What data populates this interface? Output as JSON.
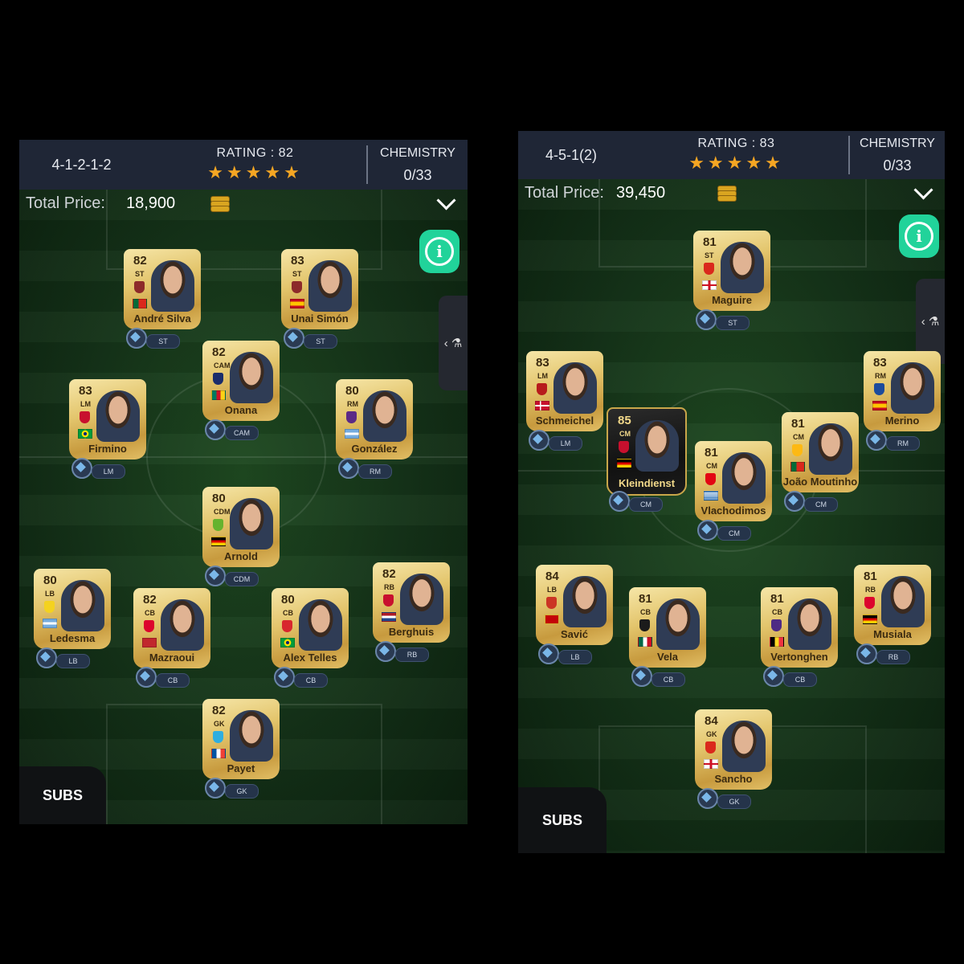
{
  "panels": [
    {
      "formation": "4-1-2-1-2",
      "rating": "RATING : 82",
      "stars": "★★★★★",
      "chemistry_label": "CHEMISTRY",
      "chemistry_value": "0/33",
      "price_label": "Total Price:",
      "price_value": "18,900",
      "subs_label": "SUBS",
      "players": [
        {
          "name": "André Silva",
          "ovr": "82",
          "pos": "ST",
          "slot": "ST",
          "flag": "portugal"
        },
        {
          "name": "Unai Simón",
          "ovr": "83",
          "pos": "ST",
          "slot": "ST",
          "flag": "spain"
        },
        {
          "name": "Onana",
          "ovr": "82",
          "pos": "CAM",
          "slot": "CAM",
          "flag": "cameroon"
        },
        {
          "name": "Firmino",
          "ovr": "83",
          "pos": "LM",
          "slot": "LM",
          "flag": "brazil"
        },
        {
          "name": "González",
          "ovr": "80",
          "pos": "RM",
          "slot": "RM",
          "flag": "argentina"
        },
        {
          "name": "Arnold",
          "ovr": "80",
          "pos": "CDM",
          "slot": "CDM",
          "flag": "germany"
        },
        {
          "name": "Ledesma",
          "ovr": "80",
          "pos": "LB",
          "slot": "LB",
          "flag": "argentina"
        },
        {
          "name": "Mazraoui",
          "ovr": "82",
          "pos": "CB",
          "slot": "CB",
          "flag": "morocco"
        },
        {
          "name": "Alex Telles",
          "ovr": "80",
          "pos": "CB",
          "slot": "CB",
          "flag": "brazil"
        },
        {
          "name": "Berghuis",
          "ovr": "82",
          "pos": "RB",
          "slot": "RB",
          "flag": "netherlands"
        },
        {
          "name": "Payet",
          "ovr": "82",
          "pos": "GK",
          "slot": "GK",
          "flag": "france"
        }
      ]
    },
    {
      "formation": "4-5-1(2)",
      "rating": "RATING : 83",
      "stars": "★★★★★",
      "chemistry_label": "CHEMISTRY",
      "chemistry_value": "0/33",
      "price_label": "Total Price:",
      "price_value": "39,450",
      "subs_label": "SUBS",
      "players": [
        {
          "name": "Maguire",
          "ovr": "81",
          "pos": "ST",
          "slot": "ST",
          "flag": "england"
        },
        {
          "name": "Schmeichel",
          "ovr": "83",
          "pos": "LM",
          "slot": "LM",
          "flag": "denmark"
        },
        {
          "name": "Merino",
          "ovr": "83",
          "pos": "RM",
          "slot": "RM",
          "flag": "spain"
        },
        {
          "name": "Kleindienst",
          "ovr": "85",
          "pos": "CM",
          "slot": "CM",
          "flag": "germany"
        },
        {
          "name": "Vlachodimos",
          "ovr": "81",
          "pos": "CM",
          "slot": "CM",
          "flag": "greece"
        },
        {
          "name": "João Moutinho",
          "ovr": "81",
          "pos": "CM",
          "slot": "CM",
          "flag": "portugal"
        },
        {
          "name": "Savić",
          "ovr": "84",
          "pos": "LB",
          "slot": "LB",
          "flag": "montenegro"
        },
        {
          "name": "Vela",
          "ovr": "81",
          "pos": "CB",
          "slot": "CB",
          "flag": "mexico"
        },
        {
          "name": "Vertonghen",
          "ovr": "81",
          "pos": "CB",
          "slot": "CB",
          "flag": "belgium"
        },
        {
          "name": "Musiala",
          "ovr": "81",
          "pos": "RB",
          "slot": "RB",
          "flag": "germany"
        },
        {
          "name": "Sancho",
          "ovr": "84",
          "pos": "GK",
          "slot": "GK",
          "flag": "england"
        }
      ]
    }
  ],
  "colors": {
    "header_bg": "#1f2636",
    "star": "#f5a623",
    "refresh_button": "#21d39a",
    "card_gold": "#e3c56c"
  },
  "icons": {
    "refresh": "refresh-info-icon",
    "coin": "coin-stack-icon",
    "chevron": "chevron-down-icon",
    "side_tab": "flask-icon",
    "chemistry_chip": "chemistry-diamond-icon"
  }
}
